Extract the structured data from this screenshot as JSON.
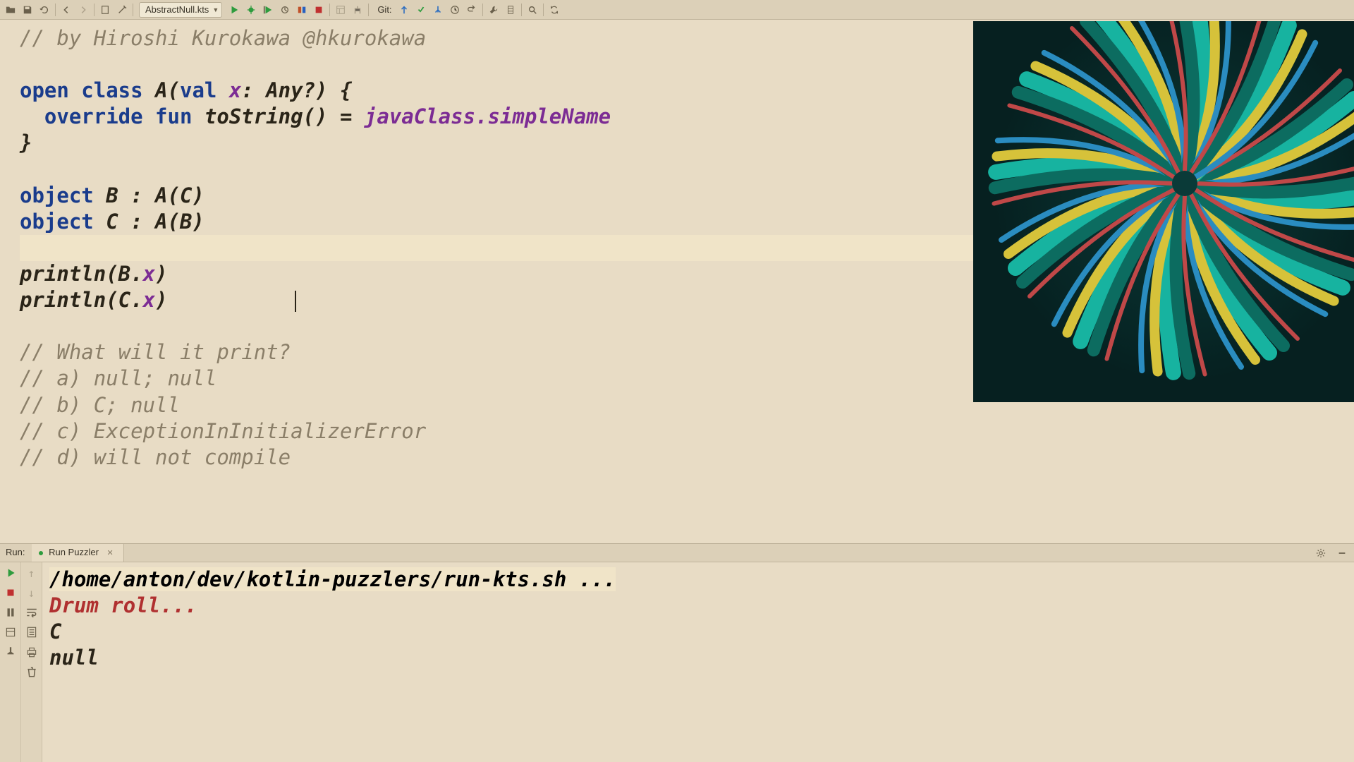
{
  "toolbar": {
    "file_name": "AbstractNull.kts",
    "git_label": "Git:"
  },
  "code": {
    "comment_author": "// by Hiroshi Kurokawa @hkurokawa",
    "line_class_open": "open class ",
    "line_class_name": "A(",
    "line_class_val": "val ",
    "line_class_param": "x",
    "line_class_rest": ": Any?) {",
    "line_override": "  override fun ",
    "line_tostring_name": "toString",
    "line_tostring_mid": "() = ",
    "line_tostring_expr": "javaClass.simpleName",
    "line_brace": "}",
    "line_obj_b_kw": "object ",
    "line_obj_b_rest": "B : A(C)",
    "line_obj_c_kw": "object ",
    "line_obj_c_rest": "C : A(B)",
    "line_print_b_fn": "println",
    "line_print_b_args": "(B.",
    "line_print_b_prop": "x",
    "line_print_b_close": ")",
    "line_print_c_fn": "println",
    "line_print_c_args": "(C.",
    "line_print_c_prop": "x",
    "line_print_c_close": ")",
    "q_title": "// What will it print?",
    "q_a": "// a) null; null",
    "q_b": "// b) C; null",
    "q_c": "// c) ExceptionInInitializerError",
    "q_d": "// d) will not compile"
  },
  "run": {
    "panel_label": "Run:",
    "tab_label": "Run Puzzler",
    "cmd": "/home/anton/dev/kotlin-puzzlers/run-kts.sh ...",
    "line_drum": "Drum roll...",
    "out1": "C",
    "out2": "null"
  },
  "icons": {
    "open": "open-icon",
    "save": "save-icon",
    "refresh": "refresh-icon",
    "back": "back-icon",
    "fwd": "forward-icon",
    "build": "build-icon",
    "run": "run-icon",
    "debug": "debug-icon",
    "stop": "stop-icon",
    "search": "search-icon",
    "gear": "gear-icon",
    "hide": "hide-icon"
  }
}
